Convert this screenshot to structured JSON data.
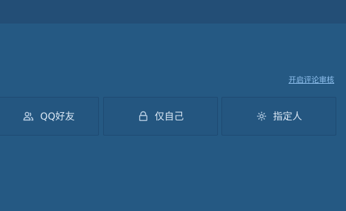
{
  "link": {
    "label": "开启评论审核"
  },
  "options": [
    {
      "label": "QQ好友",
      "icon": "users-icon"
    },
    {
      "label": "仅自己",
      "icon": "lock-icon"
    },
    {
      "label": "指定人",
      "icon": "gear-icon"
    }
  ]
}
